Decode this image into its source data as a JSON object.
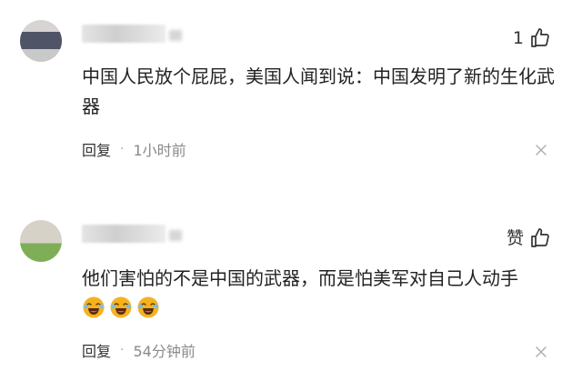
{
  "comments": [
    {
      "like_label": "1",
      "text": "中国人民放个屁屁，美国人闻到说：中国发明了新的生化武器",
      "reply_label": "回复",
      "separator": "·",
      "time": "1小时前",
      "icons": [
        "thumb-up-icon",
        "close-icon"
      ]
    },
    {
      "like_label": "赞",
      "text": "他们害怕的不是中国的武器，而是怕美军对自己人动手",
      "reply_label": "回复",
      "separator": "·",
      "time": "54分钟前",
      "emoji_count": 3,
      "icons": [
        "thumb-up-icon",
        "laughing-crying-emoji-icon",
        "close-icon"
      ]
    }
  ],
  "colors": {
    "text": "#222222",
    "muted": "#8a8a8a",
    "emoji_face": "#f5b21f"
  }
}
